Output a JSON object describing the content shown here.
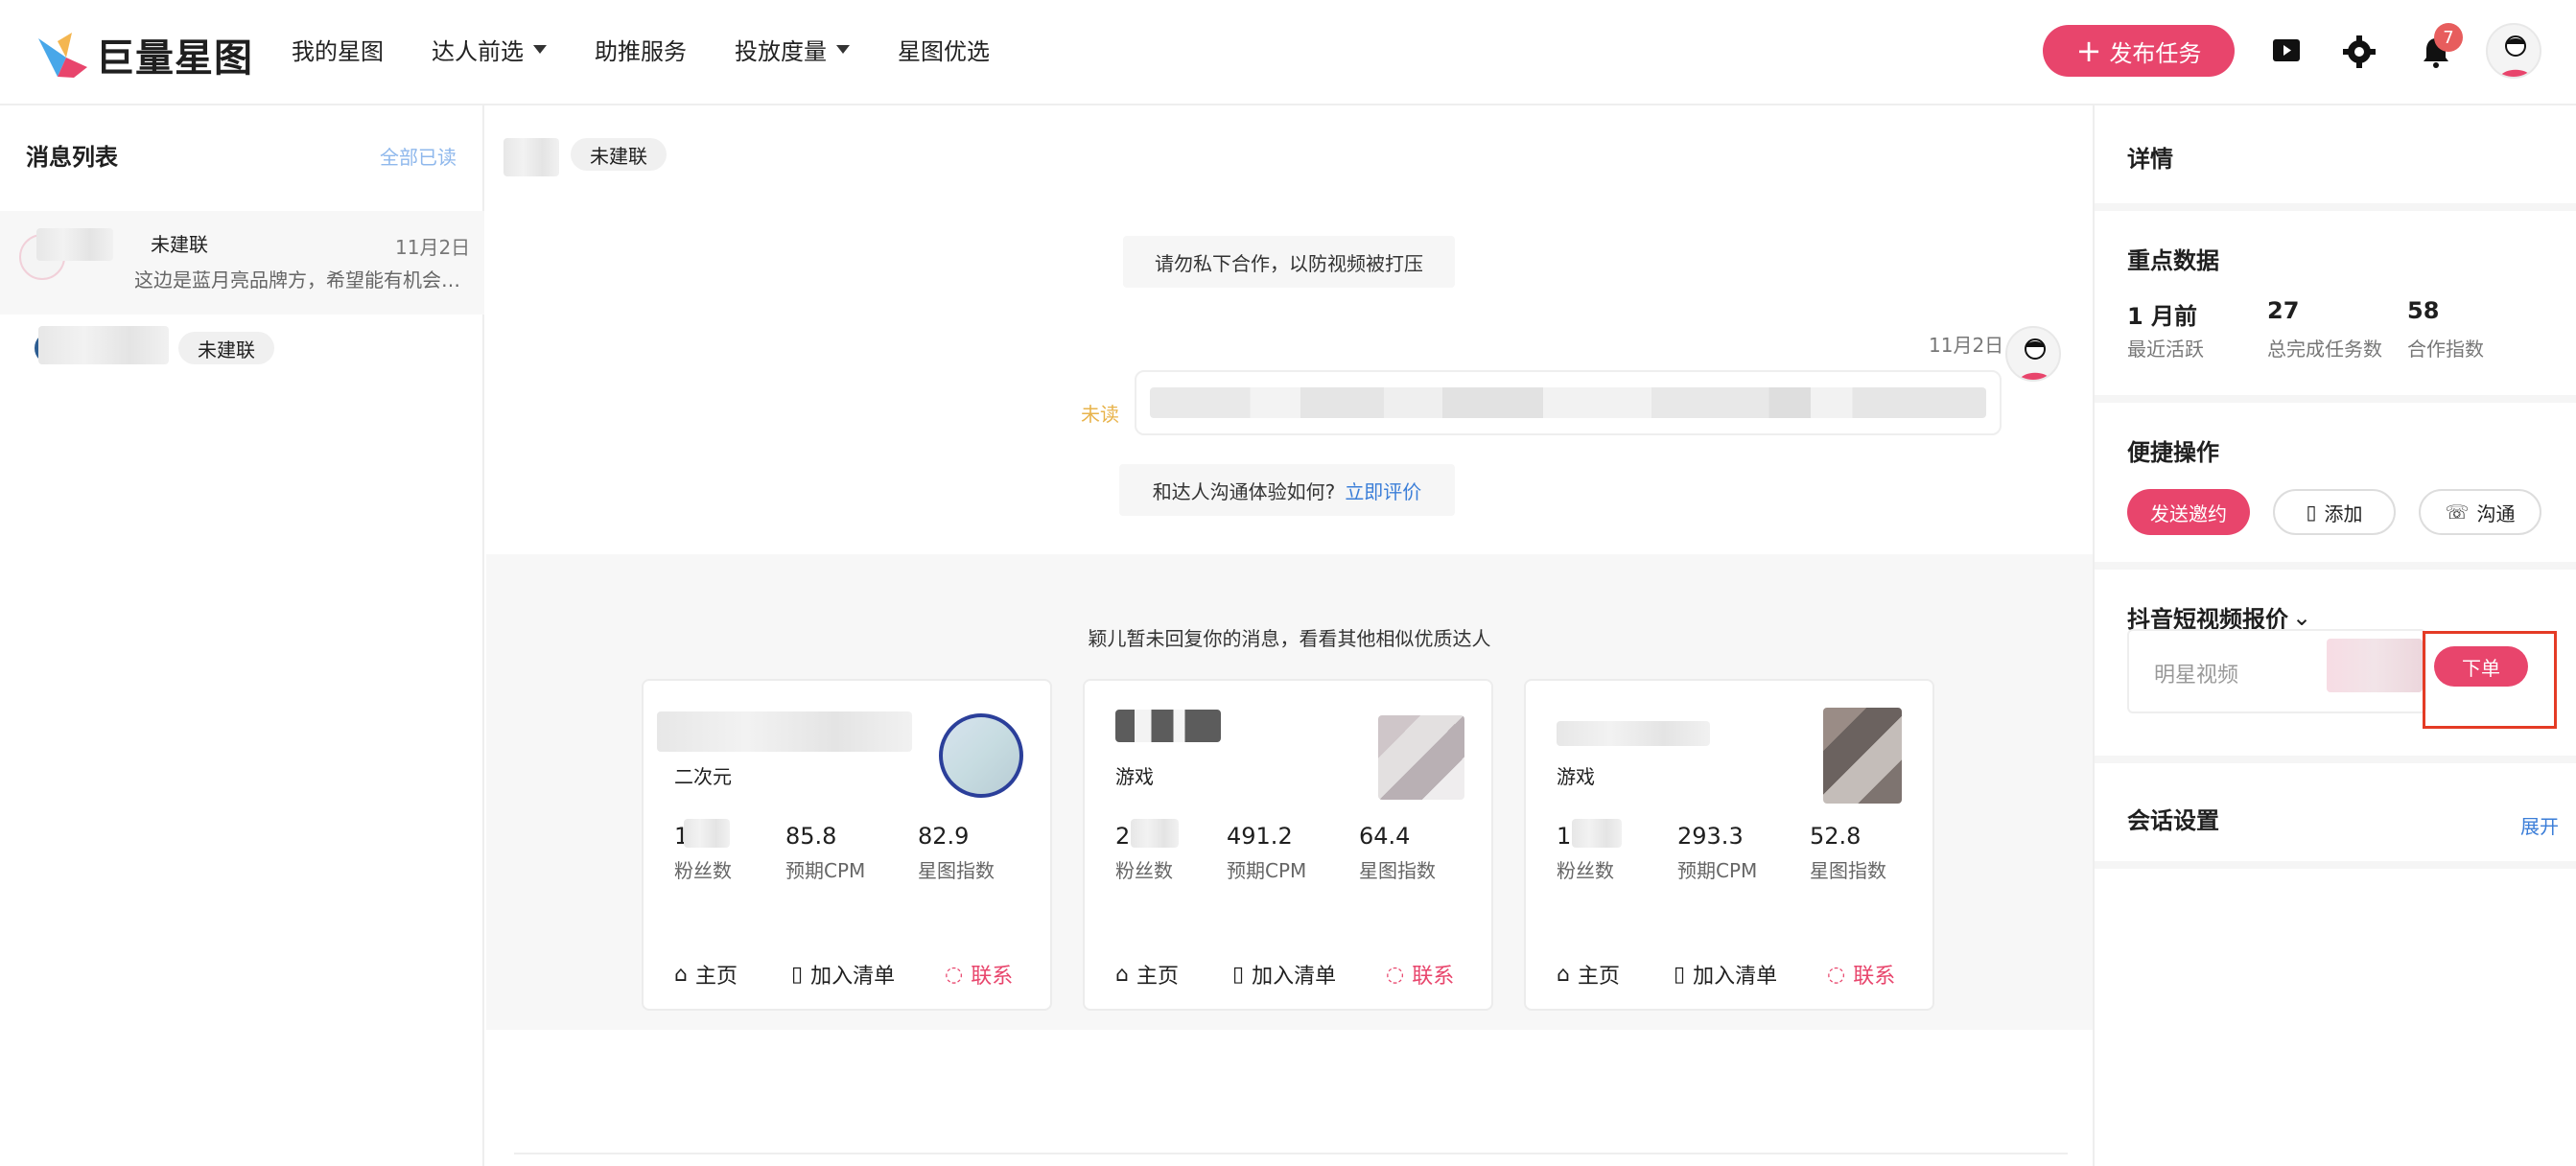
{
  "brand": {
    "logo_text": "巨量星图",
    "colors": {
      "accent": "#e8456c",
      "link": "#3b7ed8",
      "warning": "#e8b34b",
      "highlight": "#e43b25"
    }
  },
  "nav": {
    "items": [
      {
        "label": "我的星图",
        "has_caret": false
      },
      {
        "label": "达人前选",
        "has_caret": true
      },
      {
        "label": "助推服务",
        "has_caret": false
      },
      {
        "label": "投放度量",
        "has_caret": true
      },
      {
        "label": "星图优选",
        "has_caret": false
      }
    ],
    "publish_label": "发布任务",
    "notification_count": "7",
    "icons": [
      "video-icon",
      "gear-icon",
      "bell-icon",
      "avatar"
    ]
  },
  "messages": {
    "title": "消息列表",
    "mark_all_read": "全部已读",
    "items": [
      {
        "status": "未建联",
        "date": "11月2日",
        "preview": "这边是蓝月亮品牌方，希望能有机会…"
      },
      {
        "status": "未建联",
        "date": "",
        "preview": ""
      }
    ]
  },
  "chat": {
    "status": "未建联",
    "notice": "请勿私下合作，以防视频被打压",
    "message_date": "11月2日",
    "unread": "未读",
    "evaluation_prompt": "和达人沟通体验如何?",
    "evaluation_link": "立即评价",
    "recommendation_title": "颖儿暂未回复你的消息，看看其他相似优质达人",
    "cards": [
      {
        "category": "二次元",
        "stats": [
          {
            "value": "1",
            "label": "粉丝数"
          },
          {
            "value": "85.8",
            "label": "预期CPM"
          },
          {
            "value": "82.9",
            "label": "星图指数"
          }
        ],
        "actions": [
          {
            "label": "主页"
          },
          {
            "label": "加入清单"
          },
          {
            "label": "联系"
          }
        ]
      },
      {
        "category": "游戏",
        "stats": [
          {
            "value": "2",
            "label": "粉丝数"
          },
          {
            "value": "491.2",
            "label": "预期CPM"
          },
          {
            "value": "64.4",
            "label": "星图指数"
          }
        ],
        "actions": [
          {
            "label": "主页"
          },
          {
            "label": "加入清单"
          },
          {
            "label": "联系"
          }
        ]
      },
      {
        "category": "游戏",
        "stats": [
          {
            "value": "1",
            "label": "粉丝数"
          },
          {
            "value": "293.3",
            "label": "预期CPM"
          },
          {
            "value": "52.8",
            "label": "星图指数"
          }
        ],
        "actions": [
          {
            "label": "主页"
          },
          {
            "label": "加入清单"
          },
          {
            "label": "联系"
          }
        ]
      }
    ]
  },
  "details": {
    "title": "详情",
    "key_data_title": "重点数据",
    "metrics": [
      {
        "value": "1 月前",
        "label": "最近活跃"
      },
      {
        "value": "27",
        "label": "总完成任务数"
      },
      {
        "value": "58",
        "label": "合作指数"
      }
    ],
    "quick_title": "便捷操作",
    "quick_actions": {
      "invite": "发送邀约",
      "add": "添加",
      "chat": "沟通"
    },
    "price_title": "抖音短视频报价",
    "price_option": "明星视频",
    "order_label": "下单",
    "session_title": "会话设置",
    "expand_label": "展开"
  }
}
